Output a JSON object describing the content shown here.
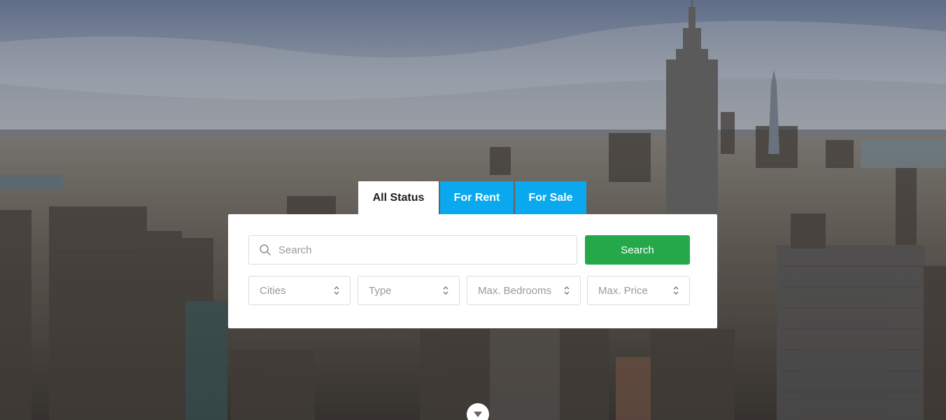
{
  "tabs": [
    {
      "label": "All Status",
      "active": true
    },
    {
      "label": "For Rent",
      "active": false
    },
    {
      "label": "For Sale",
      "active": false
    }
  ],
  "search": {
    "placeholder": "Search",
    "button_label": "Search",
    "icon": "search-icon"
  },
  "filters": [
    {
      "label": "Cities",
      "icon": "chevron-updown-icon"
    },
    {
      "label": "Type",
      "icon": "chevron-updown-icon"
    },
    {
      "label": "Max. Bedrooms",
      "icon": "chevron-updown-icon"
    },
    {
      "label": "Max. Price",
      "icon": "chevron-updown-icon"
    }
  ],
  "scroll_down": {
    "icon": "chevron-down-icon"
  },
  "colors": {
    "tab_blue": "#0aa8ee",
    "search_green": "#24a84a",
    "panel_bg": "#ffffff"
  }
}
